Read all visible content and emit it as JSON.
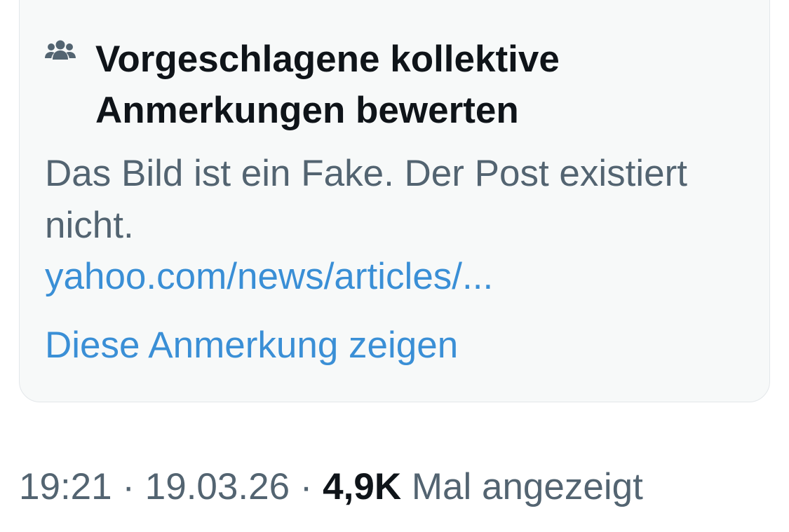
{
  "note": {
    "icon": "people-icon",
    "title": "Vorgeschlagene kollektive Anmerkungen bewerten",
    "text": "Das Bild ist ein Fake. Der Post existiert nicht.",
    "link": "yahoo.com/news/articles/...",
    "show_label": "Diese Anmerkung zeigen"
  },
  "meta": {
    "time": "19:21",
    "separator1": " · ",
    "date": "19.03.26",
    "separator2": " · ",
    "views": "4,9K",
    "views_label": " Mal angezeigt"
  },
  "colors": {
    "card_bg": "#f7f9f9",
    "title": "#0f1419",
    "secondary_text": "#536471",
    "link": "#3a8fd6"
  }
}
